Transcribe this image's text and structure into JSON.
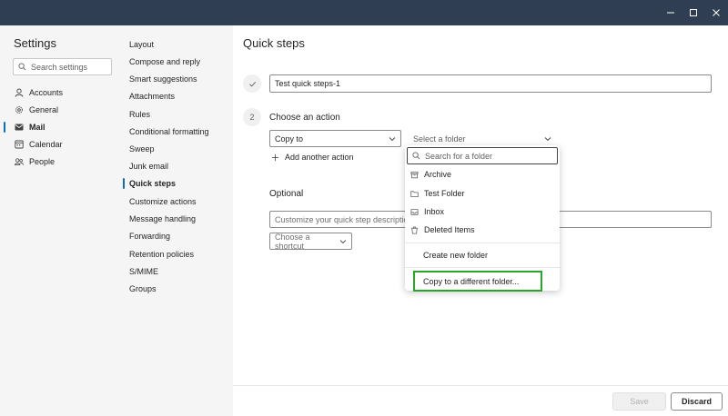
{
  "window": {
    "controls": [
      "minimize-icon",
      "maximize-icon",
      "close-icon"
    ]
  },
  "settings_nav": {
    "title": "Settings",
    "search_placeholder": "Search settings",
    "items": [
      {
        "label": "Accounts",
        "icon": "person-icon"
      },
      {
        "label": "General",
        "icon": "gear-icon"
      },
      {
        "label": "Mail",
        "icon": "mail-icon"
      },
      {
        "label": "Calendar",
        "icon": "calendar-icon"
      },
      {
        "label": "People",
        "icon": "people-icon"
      }
    ],
    "active": "Mail"
  },
  "sub_nav": {
    "items": [
      "Layout",
      "Compose and reply",
      "Smart suggestions",
      "Attachments",
      "Rules",
      "Conditional formatting",
      "Sweep",
      "Junk email",
      "Quick steps",
      "Customize actions",
      "Message handling",
      "Forwarding",
      "Retention policies",
      "S/MIME",
      "Groups"
    ],
    "active": "Quick steps"
  },
  "main": {
    "title": "Quick steps",
    "name_value": "Test quick steps-1",
    "step2_number": "2",
    "choose_action_label": "Choose an action",
    "action_value": "Copy to",
    "folder_placeholder": "Select a folder",
    "add_action_label": "Add another action",
    "optional_label": "Optional",
    "description_placeholder": "Customize your quick step description",
    "shortcut_placeholder": "Choose a shortcut",
    "save_label": "Save",
    "discard_label": "Discard"
  },
  "folder_dropdown": {
    "search_placeholder": "Search for a folder",
    "folders": [
      {
        "label": "Archive",
        "icon": "archive-icon"
      },
      {
        "label": "Test Folder",
        "icon": "folder-icon"
      },
      {
        "label": "Inbox",
        "icon": "inbox-icon"
      },
      {
        "label": "Deleted Items",
        "icon": "trash-icon"
      }
    ],
    "create_new": "Create new folder",
    "copy_different": "Copy to a different folder..."
  },
  "colors": {
    "titlebar": "#2f3e52",
    "accent": "#0f6cbd",
    "highlight_border": "#2aa52a"
  }
}
